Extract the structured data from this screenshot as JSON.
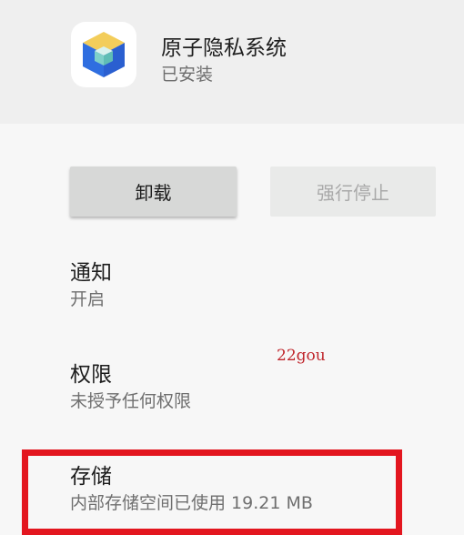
{
  "app": {
    "name": "原子隐私系统",
    "status": "已安装",
    "icon": "cube-app-icon"
  },
  "buttons": {
    "uninstall": "卸载",
    "force_stop": "强行停止"
  },
  "settings": [
    {
      "title": "通知",
      "subtitle": "开启"
    },
    {
      "title": "权限",
      "subtitle": "未授予任何权限"
    },
    {
      "title": "存储",
      "subtitle": "内部存储空间已使用 19.21 MB"
    }
  ],
  "watermark": "22gou",
  "colors": {
    "highlight": "#e3161f",
    "watermark": "#c0262c",
    "icon_yellow": "#f3cd5a",
    "icon_blue": "#2f6ee0",
    "icon_teal": "#7fd0c9"
  }
}
